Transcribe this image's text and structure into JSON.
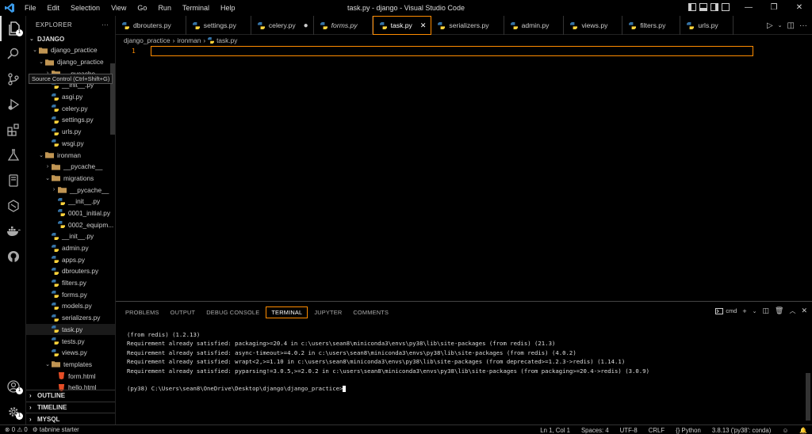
{
  "window": {
    "title": "task.py - django - Visual Studio Code",
    "menu": [
      "File",
      "Edit",
      "Selection",
      "View",
      "Go",
      "Run",
      "Terminal",
      "Help"
    ]
  },
  "colors": {
    "accent": "#ff8c00",
    "python_blue": "#3572A5",
    "python_yellow": "#FFD43B",
    "folder": "#c09553"
  },
  "activity": {
    "items": [
      "explorer-icon",
      "search-icon",
      "source-control-icon",
      "run-debug-icon",
      "extensions-icon",
      "testing-icon",
      "remote-explorer-icon",
      "ssh-icon",
      "docker-icon",
      "github-icon"
    ],
    "account_badge": "1",
    "settings_badge": "1"
  },
  "tooltip": "Source Control (Ctrl+Shift+G)",
  "sidebar": {
    "header": "EXPLORER",
    "more": "···",
    "workspace": "DJANGO",
    "tree": [
      {
        "label": "django_practice",
        "depth": 1,
        "kind": "folder",
        "open": true
      },
      {
        "label": "django_practice",
        "depth": 2,
        "kind": "folder",
        "open": true
      },
      {
        "label": "__pycache__",
        "depth": 3,
        "kind": "folder",
        "open": false
      },
      {
        "label": "__init__.py",
        "depth": 3,
        "kind": "py"
      },
      {
        "label": "asgi.py",
        "depth": 3,
        "kind": "py"
      },
      {
        "label": "celery.py",
        "depth": 3,
        "kind": "py"
      },
      {
        "label": "settings.py",
        "depth": 3,
        "kind": "py"
      },
      {
        "label": "urls.py",
        "depth": 3,
        "kind": "py"
      },
      {
        "label": "wsgi.py",
        "depth": 3,
        "kind": "py"
      },
      {
        "label": "ironman",
        "depth": 2,
        "kind": "folder",
        "open": true
      },
      {
        "label": "__pycache__",
        "depth": 3,
        "kind": "folder",
        "open": false
      },
      {
        "label": "migrations",
        "depth": 3,
        "kind": "folder",
        "open": true
      },
      {
        "label": "__pycache__",
        "depth": 4,
        "kind": "folder",
        "open": false
      },
      {
        "label": "__init__.py",
        "depth": 4,
        "kind": "py"
      },
      {
        "label": "0001_initial.py",
        "depth": 4,
        "kind": "py"
      },
      {
        "label": "0002_equipm...",
        "depth": 4,
        "kind": "py"
      },
      {
        "label": "__init__.py",
        "depth": 3,
        "kind": "py"
      },
      {
        "label": "admin.py",
        "depth": 3,
        "kind": "py"
      },
      {
        "label": "apps.py",
        "depth": 3,
        "kind": "py"
      },
      {
        "label": "dbrouters.py",
        "depth": 3,
        "kind": "py"
      },
      {
        "label": "filters.py",
        "depth": 3,
        "kind": "py"
      },
      {
        "label": "forms.py",
        "depth": 3,
        "kind": "py"
      },
      {
        "label": "models.py",
        "depth": 3,
        "kind": "py"
      },
      {
        "label": "serializers.py",
        "depth": 3,
        "kind": "py"
      },
      {
        "label": "task.py",
        "depth": 3,
        "kind": "py",
        "selected": true
      },
      {
        "label": "tests.py",
        "depth": 3,
        "kind": "py"
      },
      {
        "label": "views.py",
        "depth": 3,
        "kind": "py"
      },
      {
        "label": "templates",
        "depth": 3,
        "kind": "folder",
        "open": true
      },
      {
        "label": "form.html",
        "depth": 4,
        "kind": "html"
      },
      {
        "label": "hello.html",
        "depth": 4,
        "kind": "html"
      }
    ],
    "collapsed_sections": [
      "OUTLINE",
      "TIMELINE",
      "MYSQL"
    ]
  },
  "tabs": [
    {
      "label": "dbrouters.py",
      "state": ""
    },
    {
      "label": "settings.py",
      "state": ""
    },
    {
      "label": "celery.py",
      "state": "dirty"
    },
    {
      "label": "forms.py",
      "state": "preview"
    },
    {
      "label": "task.py",
      "state": "active"
    },
    {
      "label": "serializers.py",
      "state": ""
    },
    {
      "label": "admin.py",
      "state": ""
    },
    {
      "label": "views.py",
      "state": ""
    },
    {
      "label": "filters.py",
      "state": ""
    },
    {
      "label": "urls.py",
      "state": ""
    }
  ],
  "tab_glyphs": {
    "dirty": "●",
    "close": "✕"
  },
  "breadcrumbs": [
    "django_practice",
    "ironman",
    "task.py"
  ],
  "editor": {
    "line_number": "1"
  },
  "panel": {
    "tabs": [
      "PROBLEMS",
      "OUTPUT",
      "DEBUG CONSOLE",
      "TERMINAL",
      "JUPYTER",
      "COMMENTS"
    ],
    "active_tab": "TERMINAL",
    "shell": "cmd",
    "terminal_lines": [
      "(from redis) (1.2.13)",
      "Requirement already satisfied: packaging>=20.4 in c:\\users\\sean8\\miniconda3\\envs\\py38\\lib\\site-packages (from redis) (21.3)",
      "Requirement already satisfied: async-timeout>=4.0.2 in c:\\users\\sean8\\miniconda3\\envs\\py38\\lib\\site-packages (from redis) (4.0.2)",
      "Requirement already satisfied: wrapt<2,>=1.10 in c:\\users\\sean8\\miniconda3\\envs\\py38\\lib\\site-packages (from deprecated>=1.2.3->redis) (1.14.1)",
      "Requirement already satisfied: pyparsing!=3.0.5,>=2.0.2 in c:\\users\\sean8\\miniconda3\\envs\\py38\\lib\\site-packages (from packaging>=20.4->redis) (3.0.9)",
      "",
      "(py38) C:\\Users\\sean8\\OneDrive\\Desktop\\django\\django_practice>"
    ]
  },
  "status": {
    "errors": "0",
    "warnings": "0",
    "tabnine": "tabnine starter",
    "position": "Ln 1, Col 1",
    "spaces": "Spaces: 4",
    "encoding": "UTF-8",
    "eol": "CRLF",
    "language": "Python",
    "interpreter": "3.8.13 ('py38': conda)"
  }
}
